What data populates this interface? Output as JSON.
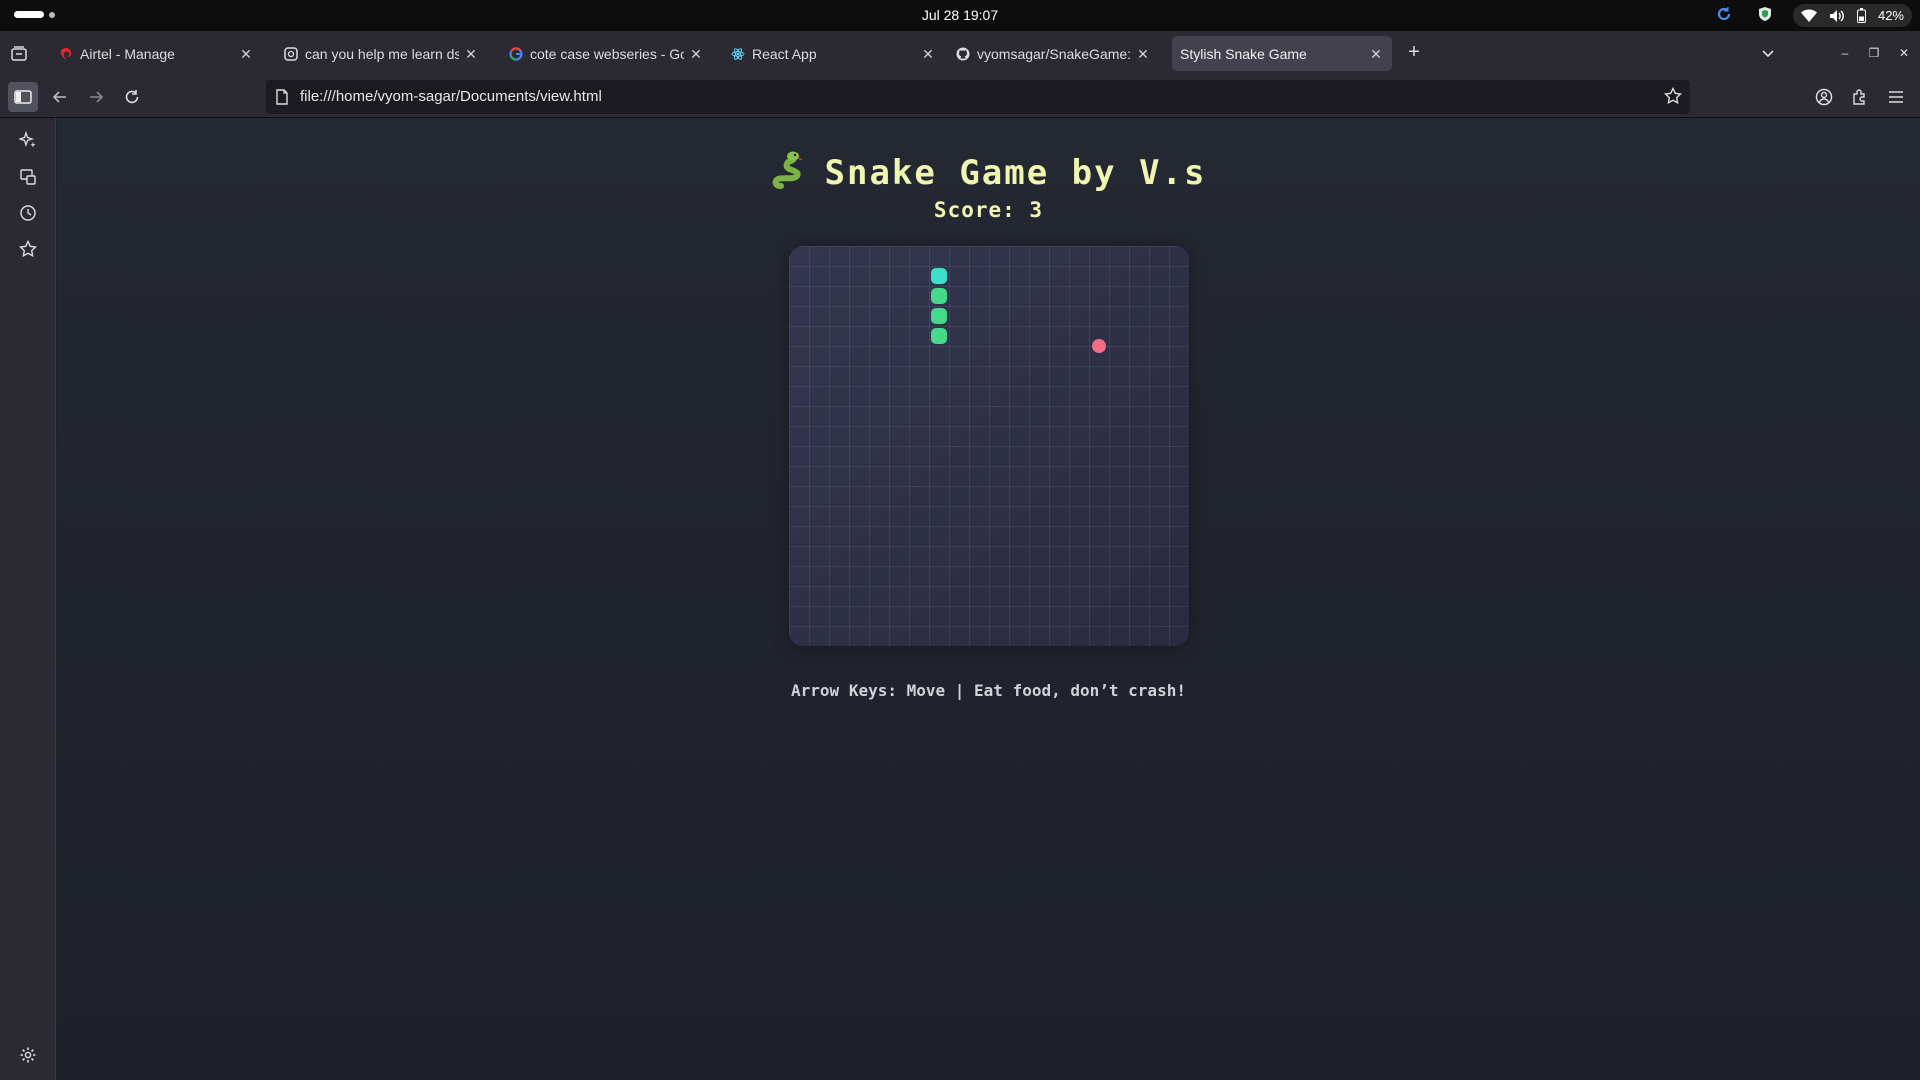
{
  "topbar": {
    "clock": "Jul 28  19:07",
    "battery": "42%"
  },
  "tabs": [
    {
      "title": "Airtel - Manage",
      "icon": "airtel-icon"
    },
    {
      "title": "can you help me learn dsa",
      "icon": "ai-chat-icon"
    },
    {
      "title": "cote case webseries - Goo",
      "icon": "google-icon"
    },
    {
      "title": "React App",
      "icon": "react-icon"
    },
    {
      "title": "vyomsagar/SnakeGame: I",
      "icon": "github-icon"
    },
    {
      "title": "Stylish Snake Game",
      "icon": "none"
    }
  ],
  "active_tab": 5,
  "navbar": {
    "url": "file:///home/vyom-sagar/Documents/view.html"
  },
  "game": {
    "emoji": "🐍",
    "title": "Snake Game by V.s",
    "score_label": "Score: 3",
    "instructions": "Arrow Keys: Move | Eat food, don’t crash!",
    "grid_cells": 20,
    "snake": [
      {
        "col": 7,
        "row": 1
      },
      {
        "col": 7,
        "row": 2
      },
      {
        "col": 7,
        "row": 3
      },
      {
        "col": 7,
        "row": 4
      }
    ],
    "food": {
      "col": 15,
      "row": 5
    },
    "colors": {
      "head": "#3ce0c8",
      "body": "#45d98a",
      "food": "#f36c86",
      "title": "#f0f5b0"
    }
  }
}
